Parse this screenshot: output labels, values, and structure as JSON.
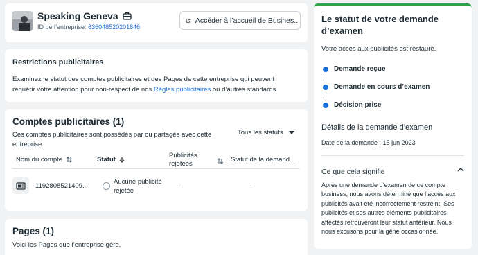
{
  "header": {
    "business_name": "Speaking Geneva",
    "business_id_label": "ID de l’entreprise:",
    "business_id": "636048520201846",
    "home_button_label": "Accéder à l’accueil de Busines..."
  },
  "restrictions": {
    "title": "Restrictions publicitaires",
    "description_prefix": "Examinez le statut des comptes publicitaires et des Pages de cette entreprise qui peuvent requérir votre attention pour non-respect de nos ",
    "link_text": "Règles publicitaires",
    "description_suffix": " ou d’autres standards."
  },
  "ad_accounts": {
    "title": "Comptes publicitaires (1)",
    "description": "Ces comptes publicitaires sont possédés par ou partagés avec cette entreprise.",
    "filter_label": "Tous les statuts",
    "columns": {
      "account_name": "Nom du compte",
      "status": "Statut",
      "rejected_ads": "Publicités rejetées",
      "request_status": "Statut de la demand..."
    },
    "rows": [
      {
        "account_id": "1192808521409...",
        "status": "Aucune publicité rejetée",
        "rejected_ads": "-",
        "request_status": "-"
      }
    ]
  },
  "pages": {
    "title": "Pages (1)",
    "description": "Voici les Pages que l’entreprise gère."
  },
  "review_panel": {
    "title": "Le statut de votre demande d’examen",
    "subtitle": "Votre accès aux publicités est restauré.",
    "steps": [
      "Demande reçue",
      "Demande en cours d’examen",
      "Décision prise"
    ],
    "details_title": "Détails de la demande d’examen",
    "request_date": "Date de la demande : 15 jun 2023",
    "meaning_title": "Ce que cela signifie",
    "meaning_text": "Après une demande d’examen de ce compte business, nous avons déterminé que l’accès aux publicités avait été incorrectement restreint. Ses publicités et ses autres éléments publicitaires affectés retrouveront leur statut antérieur. Nous nous excusons pour la gêne occasionnée."
  },
  "colors": {
    "accent": "#1a6ed8",
    "success": "#31a24c"
  }
}
